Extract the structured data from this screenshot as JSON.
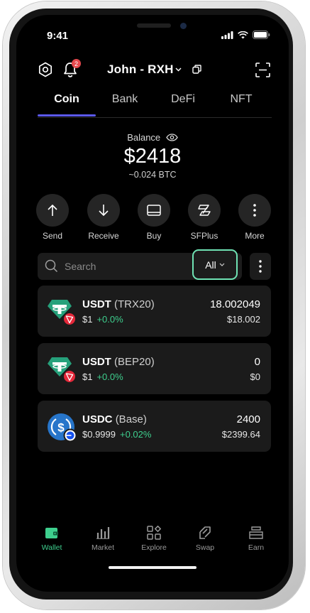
{
  "status": {
    "time": "9:41"
  },
  "header": {
    "wallet_name": "John - RXH",
    "notification_count": "2"
  },
  "tabs": [
    {
      "label": "Coin",
      "active": true
    },
    {
      "label": "Bank",
      "active": false
    },
    {
      "label": "DeFi",
      "active": false
    },
    {
      "label": "NFT",
      "active": false
    }
  ],
  "balance": {
    "label": "Balance",
    "amount": "$2418",
    "btc": "~0.024 BTC"
  },
  "actions": [
    {
      "label": "Send",
      "icon": "arrow-up-icon"
    },
    {
      "label": "Receive",
      "icon": "arrow-down-icon"
    },
    {
      "label": "Buy",
      "icon": "card-icon"
    },
    {
      "label": "SFPlus",
      "icon": "sfplus-icon"
    },
    {
      "label": "More",
      "icon": "more-vertical-icon"
    }
  ],
  "search": {
    "placeholder": "Search"
  },
  "filter": {
    "label": "All"
  },
  "assets": [
    {
      "symbol": "USDT",
      "network": "(TRX20)",
      "price": "$1",
      "change": "+0.0%",
      "quantity": "18.002049",
      "fiat": "$18.002",
      "icon": "tether-icon",
      "badge": "tron-badge-icon"
    },
    {
      "symbol": "USDT",
      "network": "(BEP20)",
      "price": "$1",
      "change": "+0.0%",
      "quantity": "0",
      "fiat": "$0",
      "icon": "tether-icon",
      "badge": "tron-badge-icon"
    },
    {
      "symbol": "USDC",
      "network": "(Base)",
      "price": "$0.9999",
      "change": "+0.02%",
      "quantity": "2400",
      "fiat": "$2399.64",
      "icon": "usdc-icon",
      "badge": "base-badge-icon"
    }
  ],
  "nav": [
    {
      "label": "Wallet",
      "active": true,
      "icon": "wallet-icon"
    },
    {
      "label": "Market",
      "active": false,
      "icon": "market-icon"
    },
    {
      "label": "Explore",
      "active": false,
      "icon": "explore-icon"
    },
    {
      "label": "Swap",
      "active": false,
      "icon": "swap-icon"
    },
    {
      "label": "Earn",
      "active": false,
      "icon": "earn-icon"
    }
  ],
  "colors": {
    "accent": "#5b59f0",
    "positive": "#3ecf8e",
    "filter_border": "#6fe3b4",
    "tether": "#26a17b",
    "usdc": "#2775ca",
    "tron": "#e5283a"
  }
}
